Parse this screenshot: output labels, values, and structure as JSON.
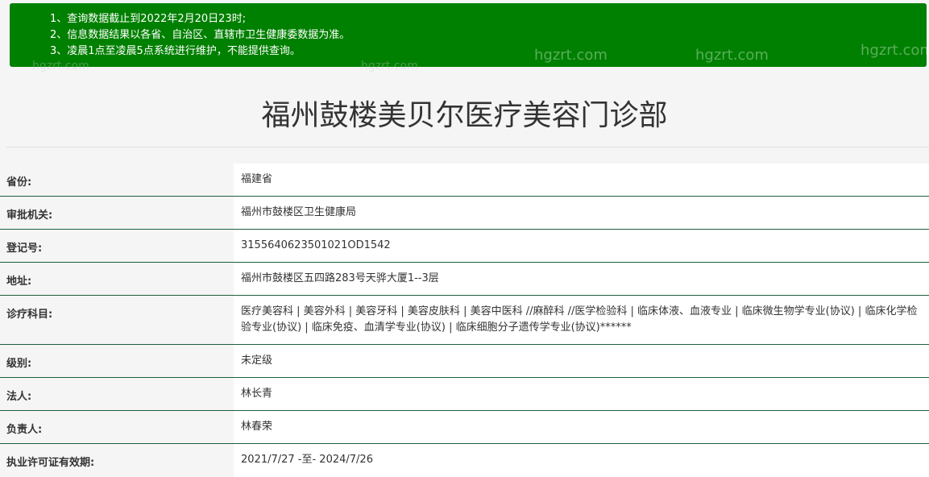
{
  "notice": {
    "lines": [
      "1、查询数据截止到2022年2月20日23时;",
      "2、信息数据结果以各省、自治区、直辖市卫生健康委数据为准。",
      "3、凌晨1点至凌晨5点系统进行维护，不能提供查询。"
    ],
    "background_color": "#008000"
  },
  "watermarks": [
    "hgzrt.com",
    "hgzrt.com",
    "hgzrt.com",
    "hgzrt.com",
    "hgzrt.com"
  ],
  "page_title": "福州鼓楼美贝尔医疗美容门诊部",
  "rows": [
    {
      "label": "省份:",
      "value": "福建省"
    },
    {
      "label": "审批机关:",
      "value": "福州市鼓楼区卫生健康局"
    },
    {
      "label": "登记号:",
      "value": "3155640623501021OD1542"
    },
    {
      "label": "地址:",
      "value": "福州市鼓楼区五四路283号天骅大厦1--3层"
    },
    {
      "label": "诊疗科目:",
      "value": "医疗美容科 | 美容外科 | 美容牙科 | 美容皮肤科 | 美容中医科 //麻醉科 //医学检验科 | 临床体液、血液专业 | 临床微生物学专业(协议) | 临床化学检验专业(协议) | 临床免疫、血清学专业(协议) | 临床细胞分子遗传学专业(协议)******"
    },
    {
      "label": "级别:",
      "value": "未定级"
    },
    {
      "label": "法人:",
      "value": "林长青"
    },
    {
      "label": "负责人:",
      "value": "林春荣"
    },
    {
      "label": "执业许可证有效期:",
      "value": "2021/7/27 -至- 2024/7/26"
    }
  ],
  "colors": {
    "row_border": "#1f5f3f",
    "page_background": "#f5f5f5",
    "value_background": "#ffffff"
  }
}
